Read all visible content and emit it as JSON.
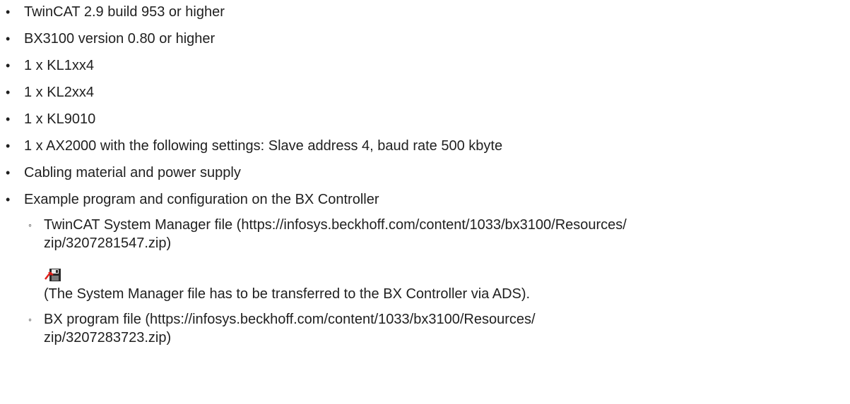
{
  "requirements": [
    "TwinCAT 2.9 build 953 or higher",
    "BX3100 version 0.80 or higher",
    "1 x KL1xx4",
    "1 x KL2xx4",
    "1 x KL9010",
    "1 x AX2000 with the following settings: Slave address 4, baud rate 500 kbyte",
    "Cabling material and power supply",
    "Example program and configuration on the BX Controller"
  ],
  "example_files": {
    "system_manager": {
      "line1": "TwinCAT System Manager file (https://infosys.beckhoff.com/content/1033/bx3100/Resources/",
      "line2": "zip/3207281547.zip)",
      "icon": "save-to-target-icon",
      "note": "(The System Manager file has to be transferred to the BX Controller via ADS)."
    },
    "bx_program": {
      "line1": "BX program file (https://infosys.beckhoff.com/content/1033/bx3100/Resources/",
      "line2": "zip/3207283723.zip)"
    }
  },
  "colors": {
    "text": "#1f1f1f",
    "icon_red": "#e0201b",
    "icon_dark": "#2a2a2a"
  }
}
